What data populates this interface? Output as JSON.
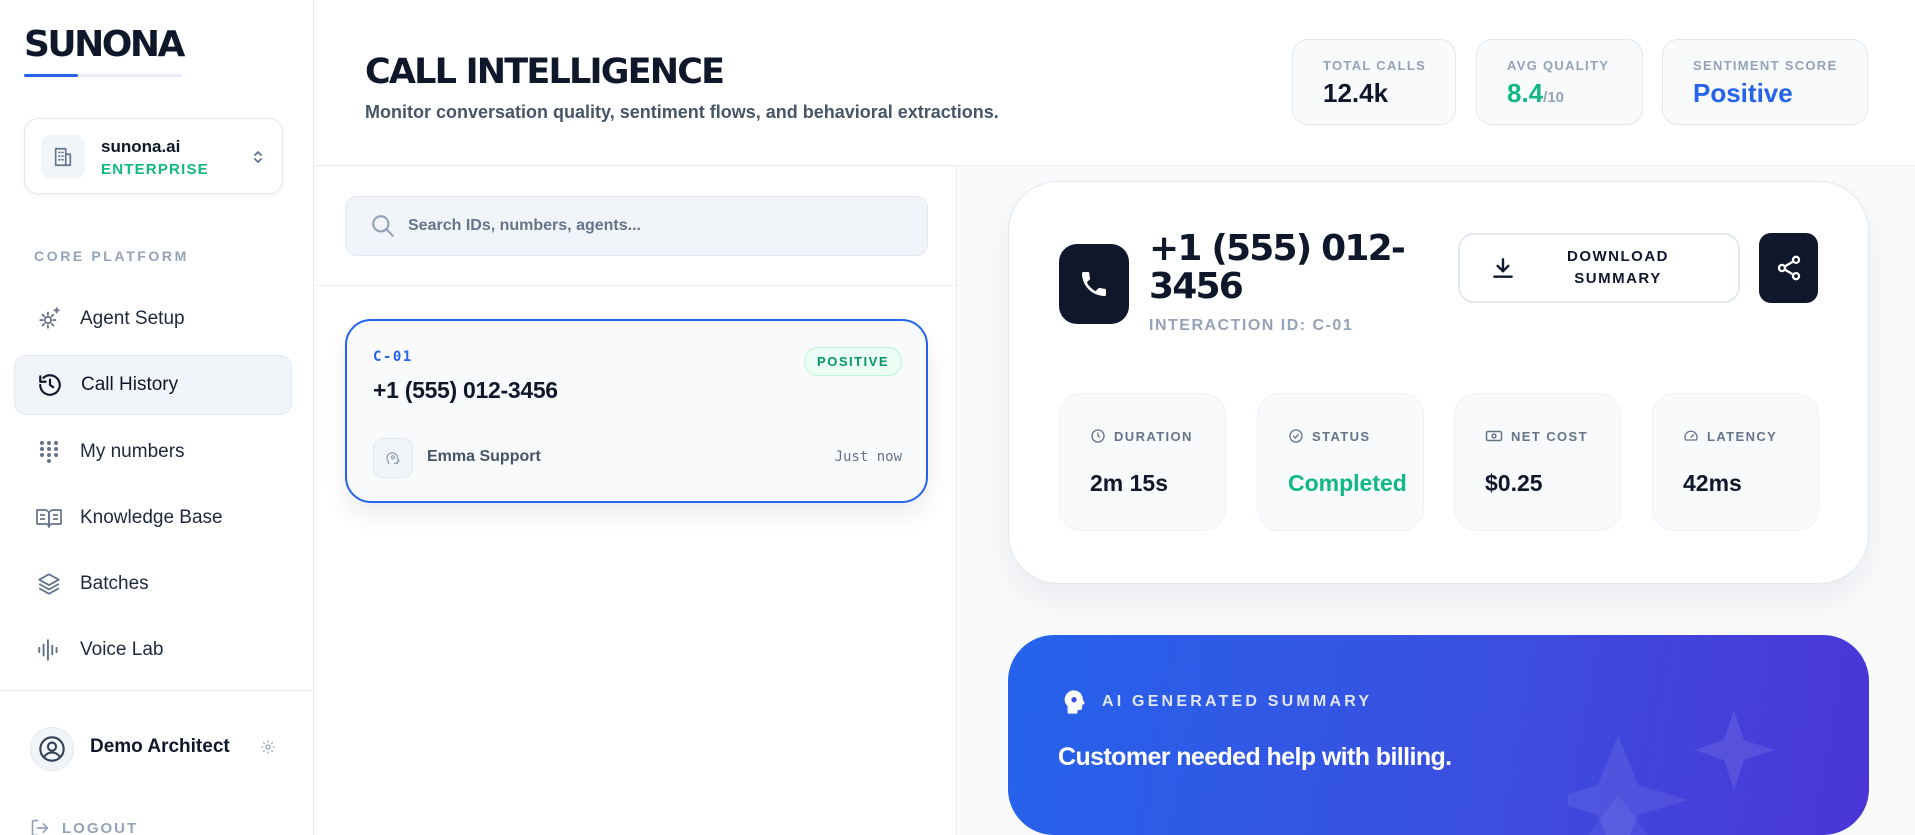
{
  "brand": {
    "logo": "SUNONA",
    "accent": "#2563eb"
  },
  "workspace": {
    "name": "sunona.ai",
    "plan": "ENTERPRISE"
  },
  "sidebar": {
    "section_label": "CORE PLATFORM",
    "items": [
      {
        "label": "Agent Setup",
        "icon": "gear-sparkle-icon",
        "active": false
      },
      {
        "label": "Call History",
        "icon": "history-icon",
        "active": true
      },
      {
        "label": "My numbers",
        "icon": "dialpad-icon",
        "active": false
      },
      {
        "label": "Knowledge Base",
        "icon": "book-icon",
        "active": false
      },
      {
        "label": "Batches",
        "icon": "layers-icon",
        "active": false
      },
      {
        "label": "Voice Lab",
        "icon": "waveform-icon",
        "active": false
      }
    ],
    "user": {
      "name": "Demo Architect"
    },
    "logout_label": "LOGOUT"
  },
  "header": {
    "title": "CALL INTELLIGENCE",
    "subtitle": "Monitor conversation quality, sentiment flows, and behavioral extractions.",
    "stats": [
      {
        "label": "TOTAL CALLS",
        "value": "12.4k",
        "suffix": ""
      },
      {
        "label": "AVG QUALITY",
        "value": "8.4",
        "suffix": "/10"
      },
      {
        "label": "SENTIMENT SCORE",
        "value": "Positive",
        "suffix": ""
      }
    ]
  },
  "search": {
    "placeholder": "Search IDs, numbers, agents...",
    "value": ""
  },
  "calls": [
    {
      "id": "C-01",
      "phone": "+1 (555) 012-3456",
      "sentiment": "POSITIVE",
      "agent": "Emma Support",
      "time": "Just now"
    }
  ],
  "detail": {
    "phone": "+1 (555) 012-3456",
    "interaction_id": "INTERACTION ID: C-01",
    "download_label": "DOWNLOAD SUMMARY",
    "metrics": [
      {
        "label": "DURATION",
        "value": "2m 15s",
        "icon": "clock-icon"
      },
      {
        "label": "STATUS",
        "value": "Completed",
        "icon": "check-circle-icon"
      },
      {
        "label": "NET COST",
        "value": "$0.25",
        "icon": "cash-icon"
      },
      {
        "label": "LATENCY",
        "value": "42ms",
        "icon": "gauge-icon"
      }
    ],
    "ai_summary": {
      "label": "AI GENERATED SUMMARY",
      "text": "Customer needed help with billing."
    }
  },
  "colors": {
    "positive": "#10b981",
    "dark": "#0f172a",
    "muted": "#94a3b8",
    "gradient_start": "#2563eb",
    "gradient_end": "#4a35d6"
  }
}
